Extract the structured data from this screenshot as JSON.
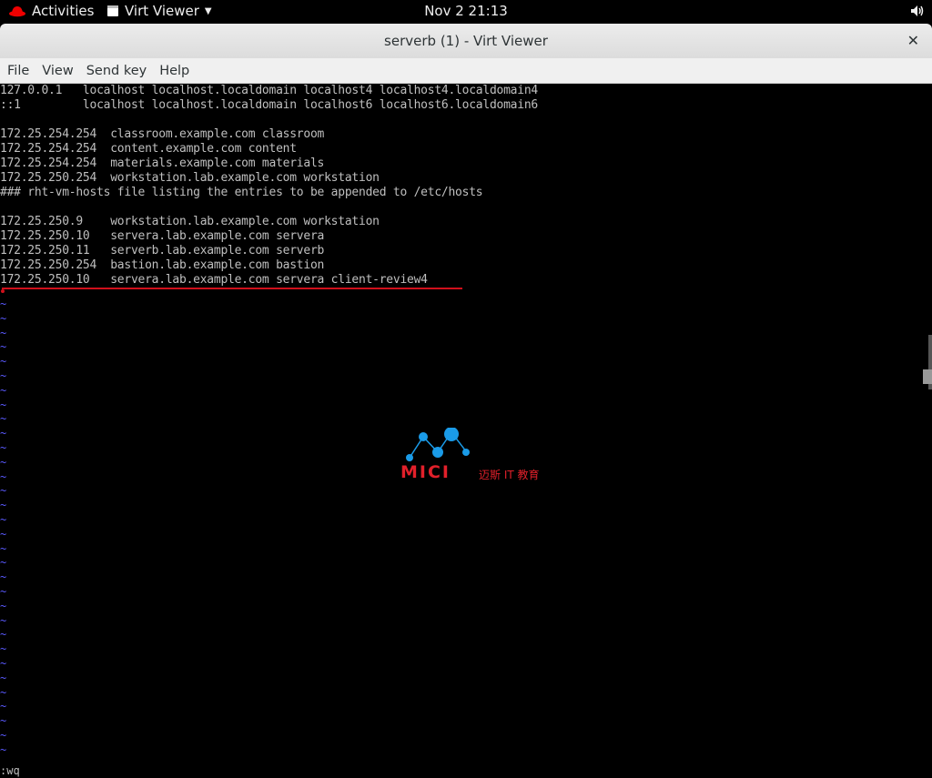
{
  "topbar": {
    "activities": "Activities",
    "app_name": "Virt Viewer",
    "clock": "Nov 2  21:13"
  },
  "window": {
    "title": "serverb (1) - Virt Viewer",
    "close": "✕",
    "menu": [
      "File",
      "View",
      "Send key",
      "Help"
    ]
  },
  "terminal": {
    "lines": [
      "127.0.0.1   localhost localhost.localdomain localhost4 localhost4.localdomain4",
      "::1         localhost localhost.localdomain localhost6 localhost6.localdomain6",
      "",
      "172.25.254.254  classroom.example.com classroom",
      "172.25.254.254  content.example.com content",
      "172.25.254.254  materials.example.com materials",
      "172.25.250.254  workstation.lab.example.com workstation",
      "### rht-vm-hosts file listing the entries to be appended to /etc/hosts",
      "",
      "172.25.250.9    workstation.lab.example.com workstation",
      "172.25.250.10   servera.lab.example.com servera",
      "172.25.250.11   serverb.lab.example.com serverb",
      "172.25.250.254  bastion.lab.example.com bastion",
      "172.25.250.10   servera.lab.example.com servera client-review4"
    ],
    "tilde": "~",
    "command": ":wq"
  },
  "watermark": {
    "brand": "MICI",
    "subtitle": "迈斯 IT 教育"
  },
  "colors": {
    "terminal_text": "#bfbfbf",
    "tilde": "#5a5aff",
    "accent_red": "#d0101b",
    "logo_blue": "#1a9be8"
  }
}
